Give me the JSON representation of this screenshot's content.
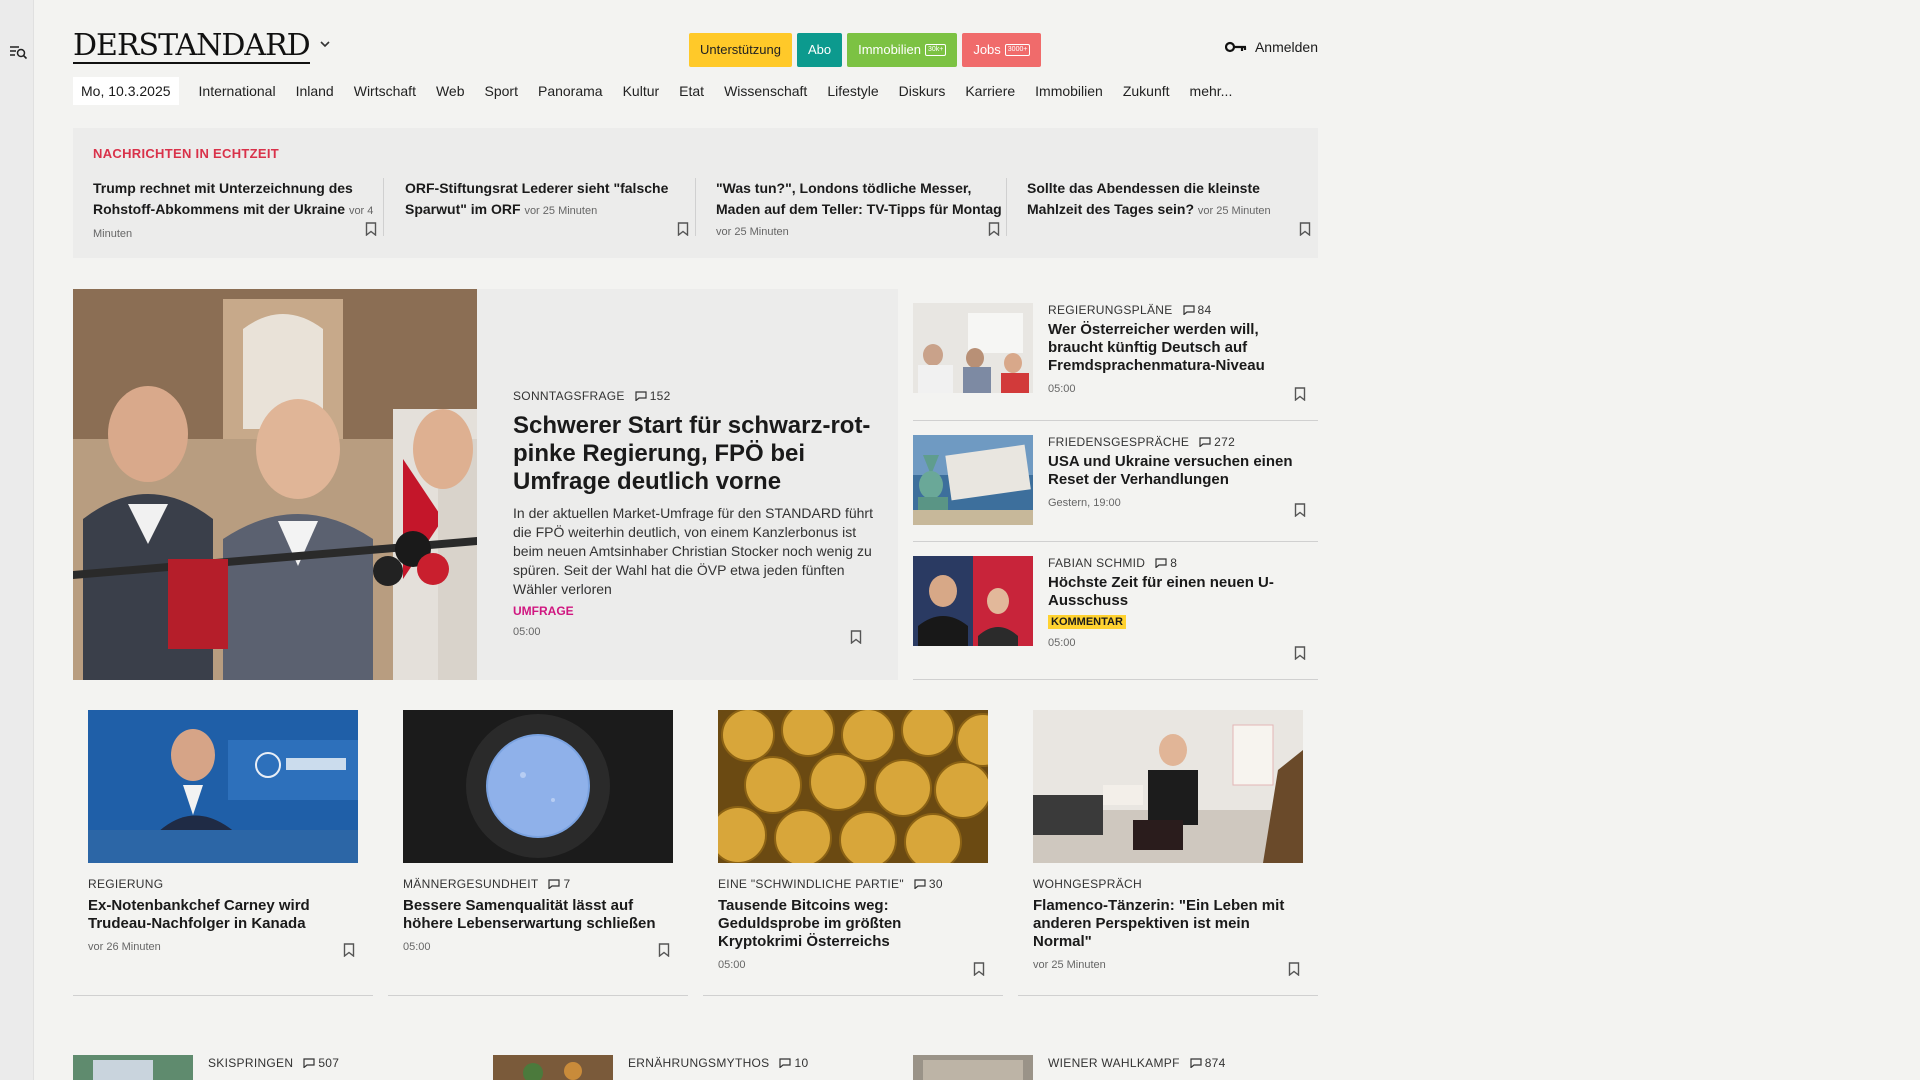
{
  "brand": {
    "logo": "DERSTANDARD"
  },
  "header": {
    "pills": [
      {
        "label": "Unterstützung",
        "bg": "#ffc929",
        "fg": "#222222"
      },
      {
        "label": "Abo",
        "bg": "#0c9a8e",
        "fg": "#ffffff"
      },
      {
        "label": "Immobilien",
        "tag": "30k+",
        "bg": "#7cc243",
        "fg": "#ffffff"
      },
      {
        "label": "Jobs",
        "tag": "3000+",
        "bg": "#f06b6b",
        "fg": "#ffffff"
      }
    ],
    "login": "Anmelden"
  },
  "nav": {
    "date": "Mo, 10.3.2025",
    "items": [
      "International",
      "Inland",
      "Wirtschaft",
      "Web",
      "Sport",
      "Panorama",
      "Kultur",
      "Etat",
      "Wissenschaft",
      "Lifestyle",
      "Diskurs",
      "Karriere",
      "Immobilien",
      "Zukunft",
      "mehr..."
    ]
  },
  "ticker": {
    "label": "NACHRICHTEN IN ECHTZEIT",
    "items": [
      {
        "title": "Trump rechnet mit Unterzeichnung des Rohstoff-Abkommens mit der Ukraine",
        "time": "vor 4 Minuten"
      },
      {
        "title": "ORF-Stiftungsrat Lederer sieht \"falsche Sparwut\" im ORF",
        "time": "vor 25 Minuten"
      },
      {
        "title": "\"Was tun?\", Londons tödliche Messer, Maden auf dem Teller: TV-Tipps für Montag",
        "time": "vor 25 Minuten"
      },
      {
        "title": "Sollte das Abendessen die kleinste Mahlzeit des Tages sein?",
        "time": "vor 25 Minuten"
      }
    ]
  },
  "lead": {
    "kicker": "SONNTAGSFRAGE",
    "comments": "152",
    "title": "Schwerer Start für schwarz-rot-pinke Regierung, FPÖ bei Umfrage deutlich vorne",
    "teaser": "In der aktuellen Market-Umfrage für den STANDARD führt die FPÖ weiterhin deutlich, von einem Kanzlerbonus ist beim neuen Amtsinhaber Christian Stocker noch wenig zu spüren. Seit der Wahl hat die ÖVP etwa jeden fünften Wähler verloren",
    "tag": "UMFRAGE",
    "time": "05:00"
  },
  "side": [
    {
      "kicker": "REGIERUNGSPLÄNE",
      "comments": "84",
      "title": "Wer Österreicher werden will, braucht künftig Deutsch auf Fremdsprachenmatura-Niveau",
      "time": "05:00"
    },
    {
      "kicker": "FRIEDENSGESPRÄCHE",
      "comments": "272",
      "title": "USA und Ukraine versuchen einen Reset der Verhandlungen",
      "time": "Gestern, 19:00"
    },
    {
      "kicker": "FABIAN SCHMID",
      "comments": "8",
      "title": "Höchste Zeit für einen neuen U-Ausschuss",
      "badge": "KOMMENTAR",
      "time": "05:00"
    }
  ],
  "grid": [
    {
      "kicker": "REGIERUNG",
      "comments": "",
      "title": "Ex-Notenbankchef Carney wird Trudeau-Nachfolger in Kanada",
      "time": "vor 26 Minuten"
    },
    {
      "kicker": "MÄNNERGESUNDHEIT",
      "comments": "7",
      "title": "Bessere Samenqualität lässt auf höhere Lebenserwartung schließen",
      "time": "05:00"
    },
    {
      "kicker": "EINE \"SCHWINDLICHE PARTIE\"",
      "comments": "30",
      "title": "Tausende Bitcoins weg: Geduldsprobe im größten Kryptokrimi Österreichs",
      "time": "05:00"
    },
    {
      "kicker": "WOHNGESPRÄCH",
      "comments": "",
      "title": "Flamenco-Tänzerin: \"Ein Leben mit anderen Perspektiven ist mein Normal\"",
      "time": "vor 25 Minuten"
    }
  ],
  "peek": [
    {
      "kicker": "SKISPRINGEN",
      "comments": "507"
    },
    {
      "kicker": "ERNÄHRUNGSMYTHOS",
      "comments": "10"
    },
    {
      "kicker": "WIENER WAHLKAMPF",
      "comments": "874"
    }
  ],
  "icons": {
    "rail": "search-menu-icon",
    "login": "key-icon",
    "bookmark": "bookmark-icon",
    "comment": "comment-icon",
    "dropdown": "chevron-down-icon"
  }
}
